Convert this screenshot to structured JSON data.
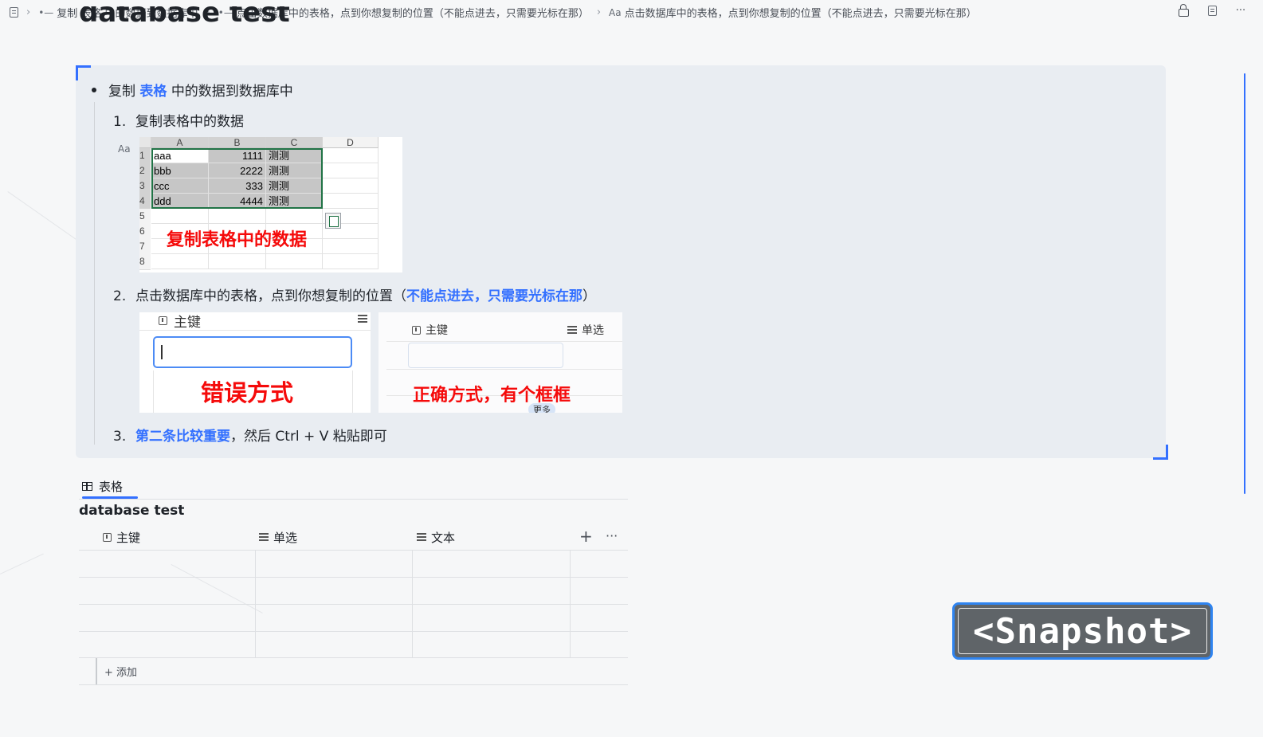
{
  "breadcrumb": {
    "items": [
      {
        "glyph": "•—",
        "label": "复制 表格 中的数据到数据库中"
      },
      {
        "glyph": "•—",
        "label": "点击数据库中的表格，点到你想复制的位置（不能点进去，只需要光标在那）"
      },
      {
        "glyph": "Aa",
        "label": "点击数据库中的表格，点到你想复制的位置（不能点进去，只需要光标在那）"
      }
    ],
    "more": "···"
  },
  "page_title": "database test",
  "content": {
    "bullet": {
      "pre": "复制",
      "highlight": "表格",
      "post": "中的数据到数据库中"
    },
    "step1": {
      "num": "1.",
      "text": "复制表格中的数据"
    },
    "step2": {
      "num": "2.",
      "text": "点击数据库中的表格，点到你想复制的位置（",
      "highlight": "不能点进去，只需要光标在那",
      "post": "）"
    },
    "step3": {
      "num": "3.",
      "highlight": "第二条比较重要",
      "text": "，然后 Ctrl + V 粘贴即可"
    },
    "aa_label": "Aa"
  },
  "excel": {
    "columns": [
      "A",
      "B",
      "C",
      "D"
    ],
    "row_numbers": [
      "1",
      "2",
      "3",
      "4",
      "5",
      "6",
      "7",
      "8"
    ],
    "rows": [
      [
        "aaa",
        "1111",
        "测测"
      ],
      [
        "bbb",
        "2222",
        "测测"
      ],
      [
        "ccc",
        "333",
        "测测"
      ],
      [
        "ddd",
        "4444",
        "测测"
      ]
    ],
    "caption": "复制表格中的数据"
  },
  "screenshot_wrong": {
    "header": "主键",
    "caption": "错误方式"
  },
  "screenshot_right": {
    "header_key": "主键",
    "header_select": "单选",
    "caption": "正确方式，有个框框",
    "more": "更多"
  },
  "database": {
    "tab_label": "表格",
    "title": "database test",
    "columns": [
      {
        "icon": "key-icon",
        "label": "主键"
      },
      {
        "icon": "list-icon",
        "label": "单选"
      },
      {
        "icon": "list-icon",
        "label": "文本"
      }
    ],
    "add_label": "+ 添加",
    "plus": "+",
    "more": "···"
  },
  "snapshot_label": "<Snapshot>",
  "colors": {
    "accent": "#3370ff",
    "caption_red": "#f50a0a",
    "excel_green": "#217346"
  }
}
